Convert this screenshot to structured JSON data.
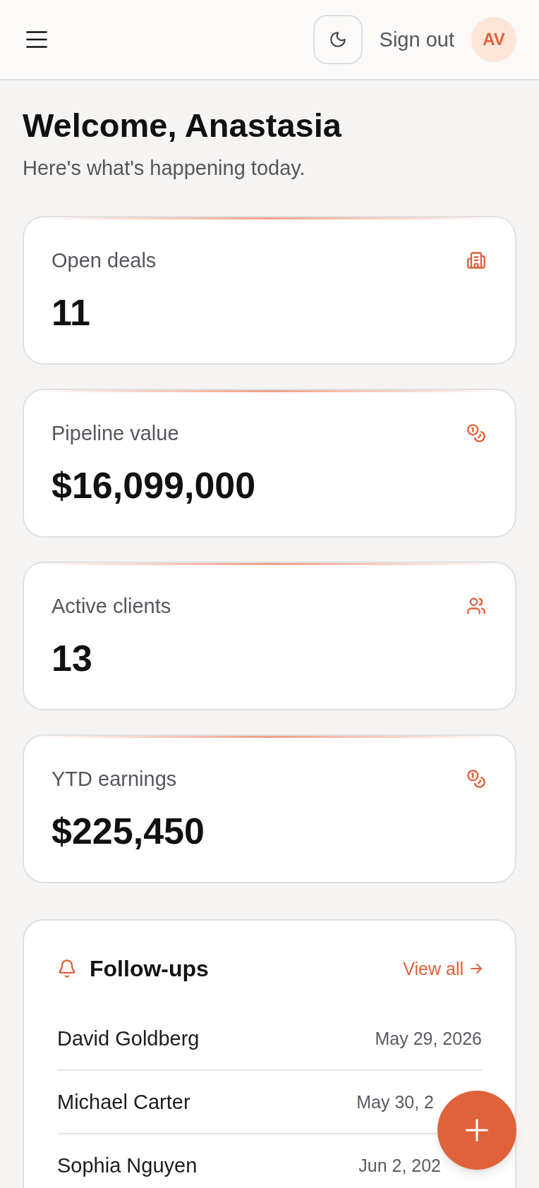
{
  "header": {
    "sign_out": "Sign out",
    "avatar": "AV"
  },
  "welcome": {
    "title": "Welcome, Anastasia",
    "subtitle": "Here's what's happening today."
  },
  "stats": [
    {
      "kind": "deals",
      "label": "Open deals",
      "value": "11"
    },
    {
      "kind": "pipeline",
      "label": "Pipeline value",
      "value": "$16,099,000"
    },
    {
      "kind": "clients",
      "label": "Active clients",
      "value": "13"
    },
    {
      "kind": "earnings",
      "label": "YTD earnings",
      "value": "$225,450"
    }
  ],
  "followups": {
    "title": "Follow-ups",
    "link": "View all",
    "items": [
      {
        "name": "David Goldberg",
        "date": "May 29, 2026"
      },
      {
        "name": "Michael Carter",
        "date": "May 30, 2"
      },
      {
        "name": "Sophia Nguyen",
        "date": "Jun 2, 202"
      }
    ]
  }
}
